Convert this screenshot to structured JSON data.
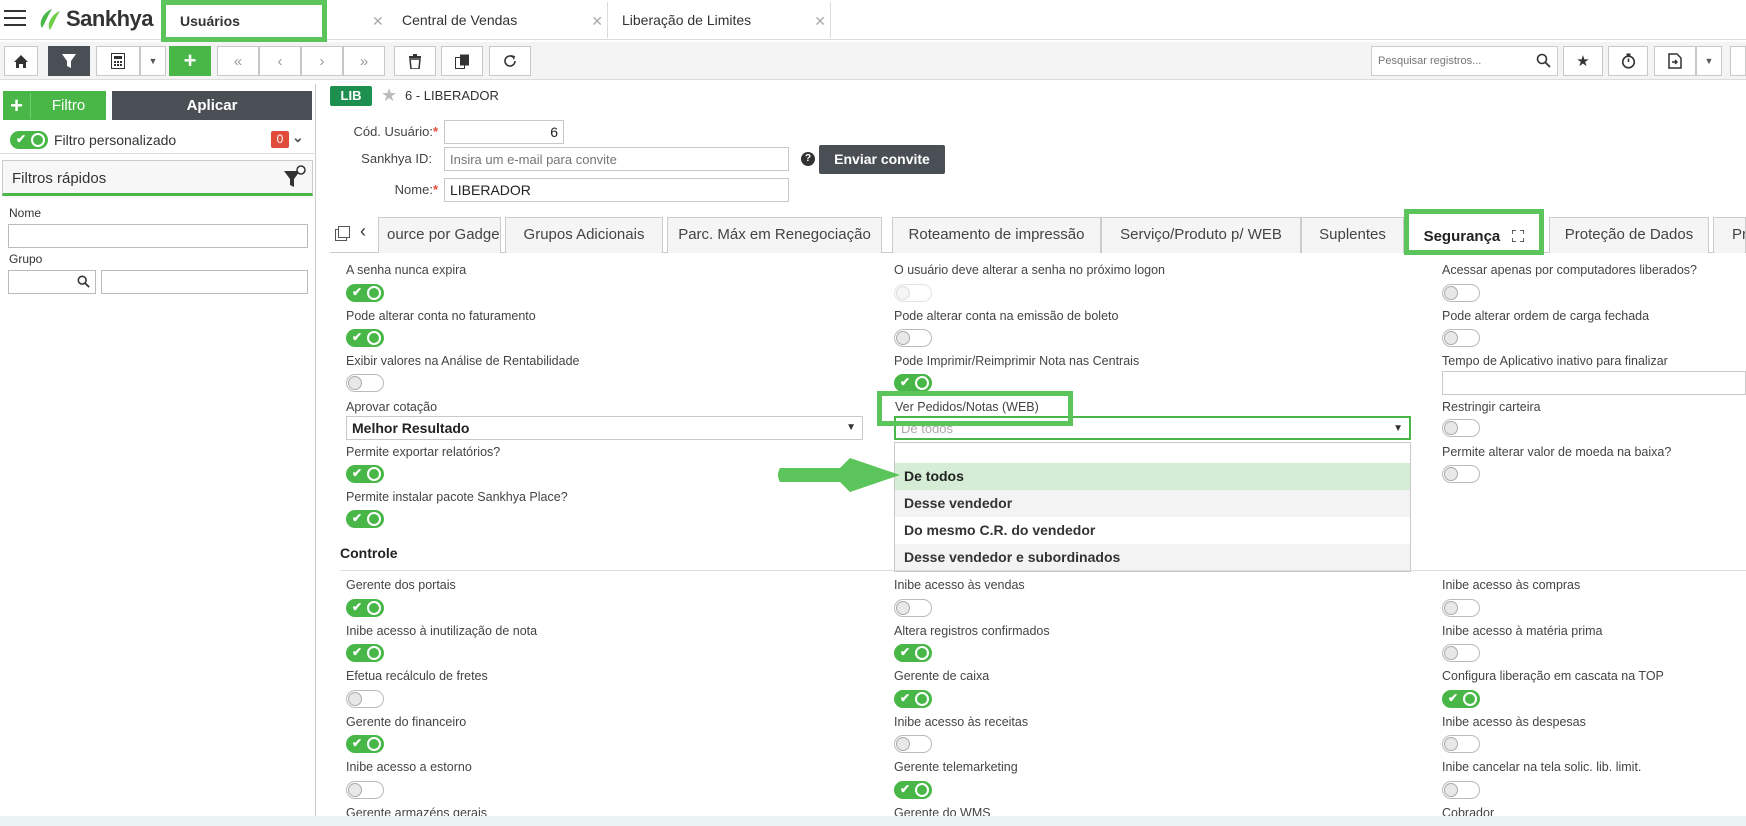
{
  "brand": {
    "name": "Sankhya",
    "color": "#48b748"
  },
  "app_tabs": [
    {
      "label": "Usuários",
      "active": true
    },
    {
      "label": "Central de Vendas"
    },
    {
      "label": "Liberação de Limites"
    }
  ],
  "toolbar": {
    "search_placeholder": "Pesquisar registros...",
    "icons": [
      "home-icon",
      "filter-icon",
      "calculator-icon",
      "dropdown-caret-icon",
      "add-icon",
      "first-record-icon",
      "previous-record-icon",
      "next-record-icon",
      "last-record-icon",
      "trash-icon",
      "copy-icon",
      "refresh-icon",
      "search-icon",
      "star-icon",
      "timer-icon",
      "export-icon"
    ]
  },
  "left_panel": {
    "filtro_label": "Filtro",
    "aplicar_label": "Aplicar",
    "filtro_personalizado": "Filtro personalizado",
    "filtro_count": "0",
    "filtros_rapidos": "Filtros rápidos",
    "nome_label": "Nome",
    "grupo_label": "Grupo"
  },
  "record": {
    "badge": "LIB",
    "title": "6 - LIBERADOR",
    "cod_usuario_label": "Cód. Usuário:",
    "cod_usuario_value": "6",
    "sankhya_id_label": "Sankhya ID:",
    "sankhya_id_placeholder": "Insira um e-mail para convite",
    "enviar_convite": "Enviar convite",
    "nome_label": "Nome:",
    "nome_value": "LIBERADOR",
    "required_mark": "*",
    "help_mark": "?"
  },
  "sub_tabs": [
    {
      "label": "ource por Gadget"
    },
    {
      "label": "Grupos Adicionais"
    },
    {
      "label": "Parc. Máx em Renegociação"
    },
    {
      "label": "Roteamento de impressão"
    },
    {
      "label": "Serviço/Produto p/ WEB"
    },
    {
      "label": "Suplentes"
    },
    {
      "label": "Segurança",
      "active": true
    },
    {
      "label": "Proteção de Dados"
    },
    {
      "label": "Pro"
    }
  ],
  "security": {
    "col1": [
      {
        "label": "A senha nunca expira",
        "state": "on"
      },
      {
        "label": "Pode alterar conta no faturamento",
        "state": "on"
      },
      {
        "label": "Exibir valores na Análise de Rentabilidade",
        "state": "off"
      },
      {
        "label": "Aprovar cotação",
        "select": "Melhor Resultado"
      },
      {
        "label": "Permite exportar relatórios?",
        "state": "on"
      },
      {
        "label": "Permite instalar pacote Sankhya Place?",
        "state": "on"
      }
    ],
    "col2": [
      {
        "label": "O usuário deve alterar a senha no próximo logon",
        "state": "disabled"
      },
      {
        "label": "Pode alterar conta na emissão de boleto",
        "state": "off"
      },
      {
        "label": "Pode Imprimir/Reimprimir Nota nas Centrais",
        "state": "on"
      },
      {
        "label": "Ver Pedidos/Notas (WEB)",
        "select": "De todos"
      }
    ],
    "col3": [
      {
        "label": "Acessar apenas por computadores liberados?",
        "state": "off"
      },
      {
        "label": "Pode alterar ordem de carga fechada",
        "state": "off"
      },
      {
        "label": "Tempo de Aplicativo inativo para finalizar",
        "input": ""
      },
      {
        "label": "Restringir carteira",
        "state": "off"
      },
      {
        "label": "Permite alterar valor de moeda na baixa?",
        "state": "off"
      }
    ],
    "dropdown_options": [
      "De todos",
      "Desse vendedor",
      "Do mesmo C.R. do vendedor",
      "Desse vendedor e subordinados"
    ]
  },
  "controle": {
    "title": "Controle",
    "col1": [
      {
        "label": "Gerente dos portais",
        "state": "on"
      },
      {
        "label": "Inibe acesso à inutilização de nota",
        "state": "on"
      },
      {
        "label": "Efetua recálculo de fretes",
        "state": "off"
      },
      {
        "label": "Gerente do financeiro",
        "state": "on"
      },
      {
        "label": "Inibe acesso a estorno",
        "state": "off"
      },
      {
        "label": "Gerente armazéns gerais"
      }
    ],
    "col2": [
      {
        "label": "Inibe acesso às vendas",
        "state": "off"
      },
      {
        "label": "Altera registros confirmados",
        "state": "on"
      },
      {
        "label": "Gerente de caixa",
        "state": "on"
      },
      {
        "label": "Inibe acesso às receitas",
        "state": "off"
      },
      {
        "label": "Gerente telemarketing",
        "state": "on"
      },
      {
        "label": "Gerente do WMS"
      }
    ],
    "col3": [
      {
        "label": "Inibe acesso às compras",
        "state": "off"
      },
      {
        "label": "Inibe acesso à matéria prima",
        "state": "off"
      },
      {
        "label": "Configura liberação em cascata na TOP",
        "state": "on"
      },
      {
        "label": "Inibe acesso às despesas",
        "state": "off"
      },
      {
        "label": "Inibe cancelar na tela solic. lib. limit.",
        "state": "off"
      },
      {
        "label": "Cobrador"
      }
    ]
  }
}
